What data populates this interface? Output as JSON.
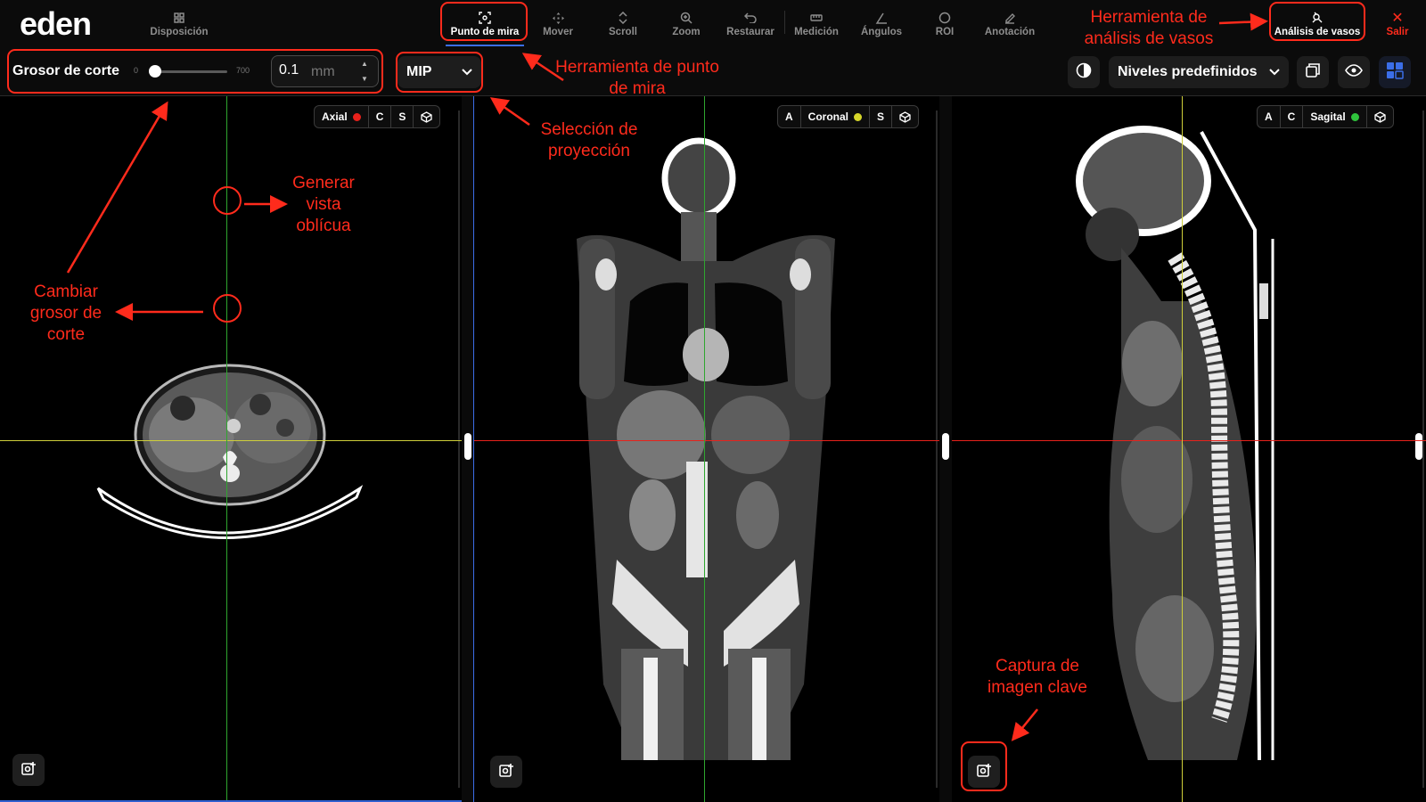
{
  "app": {
    "logo": "eden"
  },
  "toolbar": {
    "layout": "Disposición",
    "crosshair": "Punto de mira",
    "move": "Mover",
    "scroll": "Scroll",
    "zoom": "Zoom",
    "reset": "Restaurar",
    "measure": "Medición",
    "angles": "Ángulos",
    "roi": "ROI",
    "annotation": "Anotación",
    "vessel": "Análisis de vasos",
    "exit": "Salir"
  },
  "subbar": {
    "thickness_label": "Grosor de corte",
    "range_min": "0",
    "range_max": "700",
    "thickness_value": "0.1",
    "thickness_unit": "mm",
    "projection": "MIP",
    "presets": "Niveles predefinidos"
  },
  "viewports": {
    "axial": {
      "labels": [
        "Axial",
        "C",
        "S"
      ],
      "dot_color": "#e8211b"
    },
    "coronal": {
      "labels": [
        "A",
        "Coronal",
        "S"
      ],
      "dot_color": "#d6d62a"
    },
    "sagittal": {
      "labels": [
        "A",
        "C",
        "Sagital"
      ],
      "dot_color": "#2fc33c"
    }
  },
  "crosshair_colors": {
    "red": "#e8211b",
    "green": "#2fa62f",
    "yellow": "#cfcf3a"
  },
  "annotations": {
    "crosshair_tool": "Herramienta de punto de mira",
    "vessel_tool": "Herramienta de análisis de vasos",
    "projection_select": "Selección de proyección",
    "oblique_view": "Generar vista oblícua",
    "change_thickness": "Cambiar grosor de corte",
    "key_image": "Captura de imagen clave"
  }
}
